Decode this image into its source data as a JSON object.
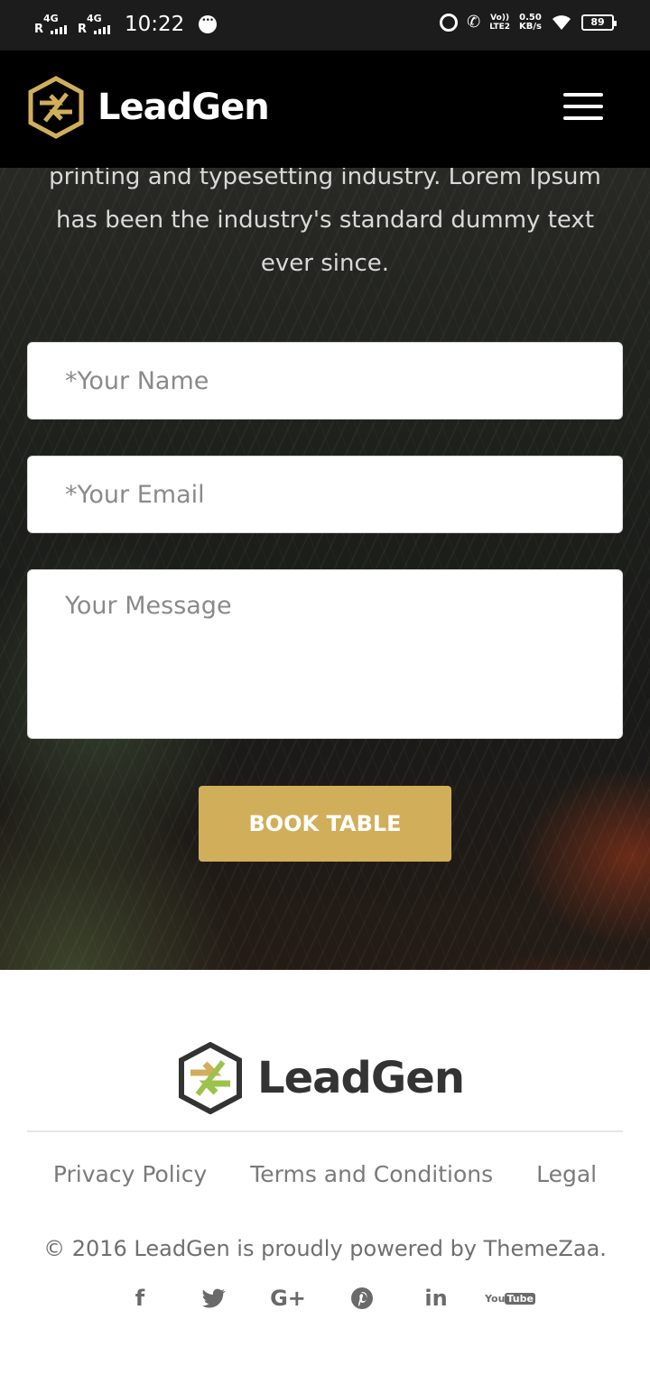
{
  "status_bar": {
    "sim1_roaming": "R",
    "sim1_network": "4G",
    "sim2_roaming": "R",
    "sim2_network": "4G",
    "time": "10:22",
    "volte_top": "Vo))",
    "volte_bottom": "LTE2",
    "speed_value": "0.50",
    "speed_unit": "KB/s",
    "battery_level": "89"
  },
  "header": {
    "brand": "LeadGen",
    "logo_color": "#d1ae5a"
  },
  "hero": {
    "intro_text": "printing and typesetting industry. Lorem Ipsum has been the industry's standard dummy text ever since."
  },
  "form": {
    "name_placeholder": "*Your Name",
    "email_placeholder": "*Your Email",
    "message_placeholder": "Your Message",
    "submit_label": "BOOK TABLE",
    "accent_color": "#d1ae5a"
  },
  "footer": {
    "brand": "LeadGen",
    "links": [
      "Privacy Policy",
      "Terms and Conditions",
      "Legal"
    ],
    "copyright": "© 2016 LeadGen is proudly powered by ThemeZaa.",
    "social_icons": [
      "facebook-icon",
      "twitter-icon",
      "google-plus-icon",
      "pinterest-icon",
      "linkedin-icon",
      "youtube-icon"
    ],
    "youtube_you": "You",
    "youtube_tube": "Tube"
  }
}
